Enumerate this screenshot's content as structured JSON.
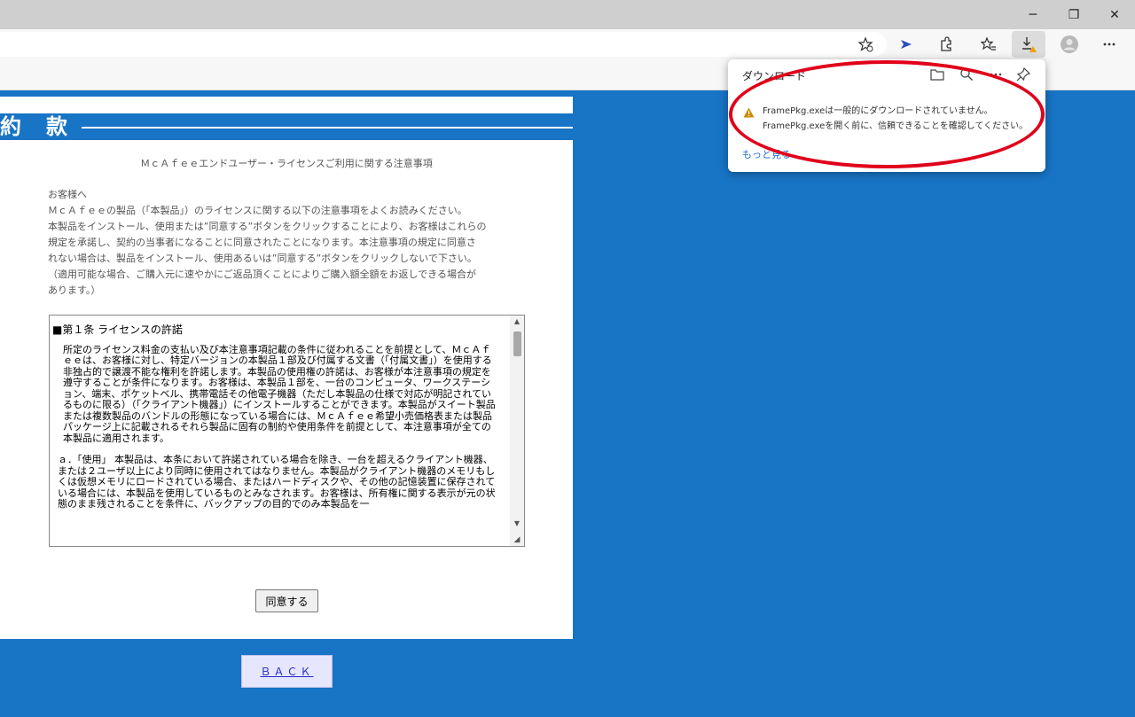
{
  "browser": {
    "window_controls": [
      "─",
      "❐",
      "✕"
    ],
    "toolbar_icons": [
      "star-add-icon",
      "extension-arrow-icon",
      "puzzle-icon",
      "favorites-icon",
      "download-warning-icon",
      "profile-icon",
      "more-icon"
    ]
  },
  "downloads": {
    "title": "ダウンロード",
    "message_line1": "FramePkg.exeは一般的にダウンロードされていません。",
    "message_line2": "FramePkg.exeを開く前に、信頼できることを確認してください。",
    "more_link": "もっと見る"
  },
  "page": {
    "header_title": "約　款",
    "notice_title": "ＭｃＡｆｅｅエンドユーザー・ライセンスご利用に関する注意事項",
    "intro": [
      "お客様へ",
      "ＭｃＡｆｅｅの製品（「本製品」）のライセンスに関する以下の注意事項をよくお読みください。",
      "本製品をインストール、使用または”同意する”ボタンをクリックすることにより、お客様はこれらの",
      "規定を承諾し、契約の当事者になることに同意されたことになります。本注意事項の規定に同意さ",
      "れない場合は、製品をインストール、使用あるいは”同意する”ボタンをクリックしないで下さい。",
      "（適用可能な場合、ご購入元に速やかにご返品頂くことによりご購入額全額をお返しできる場合が",
      "あります。）"
    ],
    "license": {
      "article_title": "■第１条 ライセンスの許諾",
      "article_body": "所定のライセンス料金の支払い及び本注意事項記載の条件に従われることを前提として、ＭｃＡｆｅｅは、お客様に対し、特定バージョンの本製品１部及び付属する文書（「付属文書」）を使用する非独占的で譲渡不能な権利を許諾します。本製品の使用権の許諾は、お客様が本注意事項の規定を遵守することが条件になります。お客様は、本製品１部を、一台のコンピュータ、ワークステーション、端末、ポケットベル、携帯電話その他電子機器（ただし本製品の仕様で対応が明記されているものに限る）（「クライアント機器」）にインストールすることができます。本製品がスイート製品または複数製品のバンドルの形態になっている場合には、ＭｃＡｆｅｅ希望小売価格表または製品パッケージ上に記載されるそれら製品に固有の制約や使用条件を前提として、本注意事項が全ての本製品に適用されます。",
      "item_a": "ａ．「使用」 本製品は、本条において許諾されている場合を除き、一台を超えるクライアント機器、または２ユーザ以上により同時に使用されてはなりません。本製品がクライアント機器のメモリもしくは仮想メモリにロードされている場合、またはハードディスクや、その他の記憶装置に保存されている場合には、本製品を使用しているものとみなされます。お客様は、所有権に関する表示が元の状態のまま残されることを条件に、バックアップの目的でのみ本製品を一"
    },
    "agree_button": "同意する",
    "back_button": "ＢＡＣＫ"
  }
}
